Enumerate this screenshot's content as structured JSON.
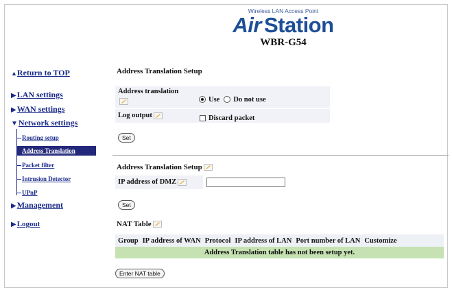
{
  "header": {
    "product_line": "Wireless LAN Access Point",
    "logo_part1": "Air",
    "logo_part2": "Station",
    "model": "WBR-G54"
  },
  "sidebar": {
    "return_top": "Return to TOP",
    "items": [
      {
        "label": "LAN settings",
        "arrow": "▶"
      },
      {
        "label": "WAN settings",
        "arrow": "▶"
      },
      {
        "label": "Network settings",
        "arrow": "▼"
      },
      {
        "label": "Management",
        "arrow": "▶"
      },
      {
        "label": "Logout",
        "arrow": "▶"
      }
    ],
    "subitems": [
      {
        "label": "Routing setup"
      },
      {
        "label": "Address Translation",
        "active": true
      },
      {
        "label": "Packet filter"
      },
      {
        "label": "Intrusion Detector"
      },
      {
        "label": "UPnP"
      }
    ]
  },
  "section1": {
    "title": "Address Translation Setup",
    "address_translation_label": "Address translation",
    "use_label": "Use",
    "do_not_use_label": "Do not use",
    "selected": "Use",
    "log_output_label": "Log output",
    "discard_packet_label": "Discard packet",
    "discard_checked": false,
    "set_label": "Set"
  },
  "section2": {
    "title": "Address Translation Setup",
    "dmz_label": "IP address of DMZ",
    "dmz_value": "",
    "set_label": "Set"
  },
  "nat": {
    "title": "NAT Table",
    "columns": [
      "Group",
      "IP address of WAN",
      "Protocol",
      "IP address of LAN",
      "Port number of LAN",
      "Customize"
    ],
    "empty_message": "Address Translation table has not been setup yet.",
    "enter_button": "Enter NAT table"
  },
  "colors": {
    "brand_blue": "#1d4f97",
    "nav_blue": "#1a2a8a",
    "active_bg": "#23287a",
    "empty_row": "#c6e2b2"
  },
  "icons": {
    "help": "pencil-help-icon"
  }
}
